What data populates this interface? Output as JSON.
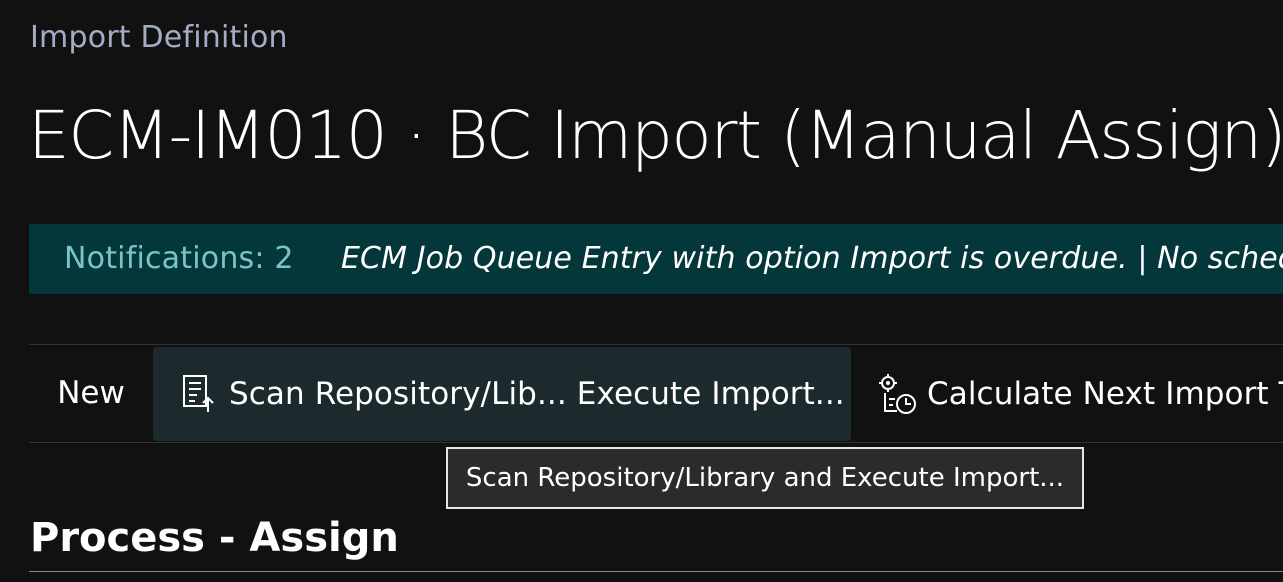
{
  "page": {
    "caption": "Import Definition",
    "title": "ECM-IM010 · BC Import (Manual Assign)"
  },
  "notifications": {
    "count_label": "Notifications: 2",
    "message": "ECM Job Queue Entry with option Import is overdue. |  No scheduled Job Queue Entry found"
  },
  "actions": {
    "new_label": "New",
    "scan_label": "Scan Repository/Lib... Execute Import...",
    "scan_icon": "document-upload-icon",
    "calc_label": "Calculate Next Import Time",
    "calc_icon": "gear-clock-icon"
  },
  "tooltip": {
    "text": "Scan Repository/Library and Execute Import..."
  },
  "section": {
    "title": "Process - Assign"
  },
  "colors": {
    "background": "#111111",
    "notification_bar": "#04373a",
    "notification_count": "#79c5c6",
    "caption": "#a3adc6",
    "hover_action": "#1c2a2e"
  }
}
